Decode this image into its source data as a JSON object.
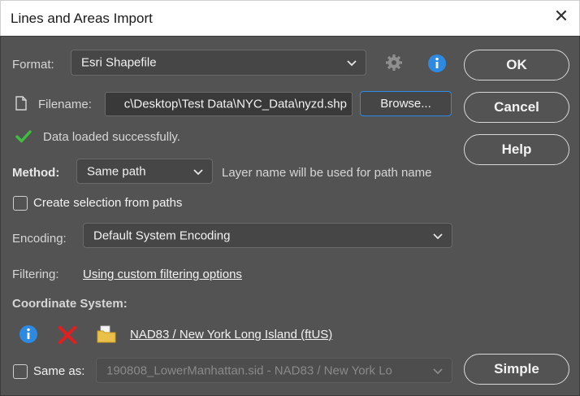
{
  "window": {
    "title": "Lines and Areas Import",
    "close_glyph": "✕"
  },
  "format": {
    "label": "Format:",
    "value": "Esri Shapefile"
  },
  "filename": {
    "label": "Filename:",
    "value": "c\\Desktop\\Test Data\\NYC_Data\\nyzd.shp",
    "browse_label": "Browse..."
  },
  "status": {
    "message": "Data loaded successfully.",
    "color": "#3fbf3f"
  },
  "method": {
    "label": "Method:",
    "value": "Same path",
    "note": "Layer name will be used for path name"
  },
  "create_selection": {
    "label": "Create selection from paths",
    "checked": false
  },
  "encoding": {
    "label": "Encoding:",
    "value": "Default System Encoding"
  },
  "filtering": {
    "label": "Filtering:",
    "link": "Using custom filtering options"
  },
  "coordinate_system": {
    "heading": "Coordinate System:",
    "link": "NAD83 / New York Long Island (ftUS)"
  },
  "same_as": {
    "label": "Same as:",
    "checked": false,
    "value": "190808_LowerManhattan.sid - NAD83 / New York Lo"
  },
  "buttons": {
    "ok": "OK",
    "cancel": "Cancel",
    "help": "Help",
    "simple": "Simple"
  },
  "colors": {
    "panel": "#535353",
    "accent_blue": "#2c8ae6",
    "info_blue": "#2d8ae0",
    "delete_red": "#e02020",
    "folder_yellow": "#e8c04a"
  }
}
